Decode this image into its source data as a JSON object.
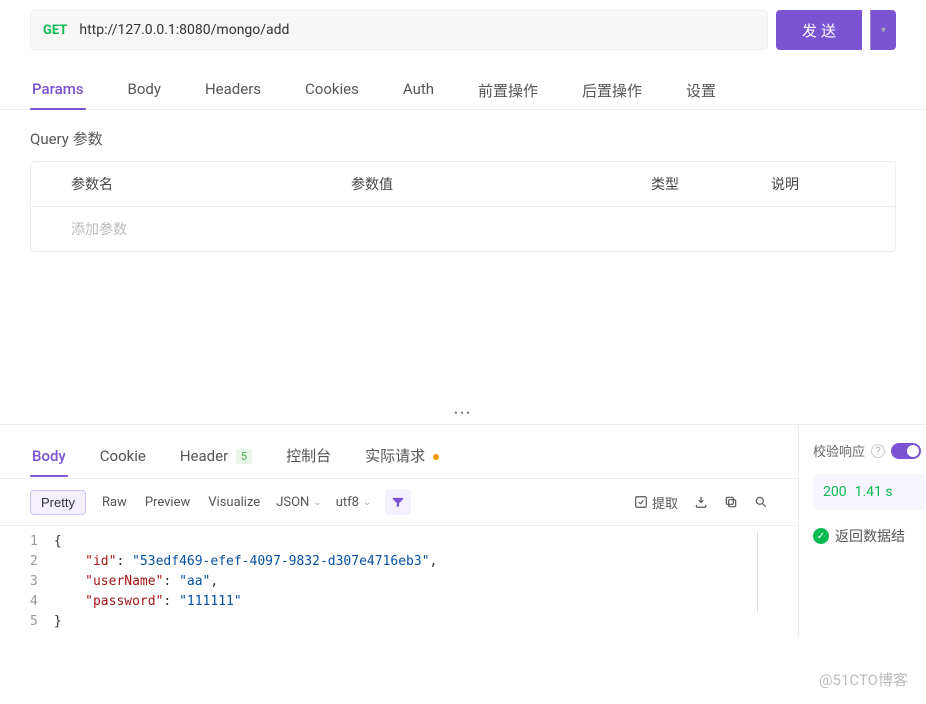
{
  "request": {
    "method": "GET",
    "url": "http://127.0.0.1:8080/mongo/add",
    "send_label": "发 送"
  },
  "req_tabs": [
    "Params",
    "Body",
    "Headers",
    "Cookies",
    "Auth",
    "前置操作",
    "后置操作",
    "设置"
  ],
  "query_title": "Query 参数",
  "params_headers": {
    "name": "参数名",
    "value": "参数值",
    "type": "类型",
    "desc": "说明"
  },
  "params_placeholder": "添加参数",
  "resp_tabs": {
    "body": "Body",
    "cookie": "Cookie",
    "header": "Header",
    "header_badge": "5",
    "console": "控制台",
    "actual": "实际请求"
  },
  "toolbar": {
    "pretty": "Pretty",
    "raw": "Raw",
    "preview": "Preview",
    "visualize": "Visualize",
    "format": "JSON",
    "encoding": "utf8",
    "extract": "提取"
  },
  "code": {
    "lines": [
      "1",
      "2",
      "3",
      "4",
      "5"
    ],
    "json": {
      "id_key": "\"id\"",
      "id_val": "\"53edf469-efef-4097-9832-d307e4716eb3\"",
      "user_key": "\"userName\"",
      "user_val": "\"aa\"",
      "pass_key": "\"password\"",
      "pass_val": "\"111111\""
    }
  },
  "right": {
    "validate_label": "校验响应",
    "status_code": "200",
    "status_time": "1.41 s",
    "success_msg": "返回数据结"
  },
  "watermark": "@51CTO博客"
}
